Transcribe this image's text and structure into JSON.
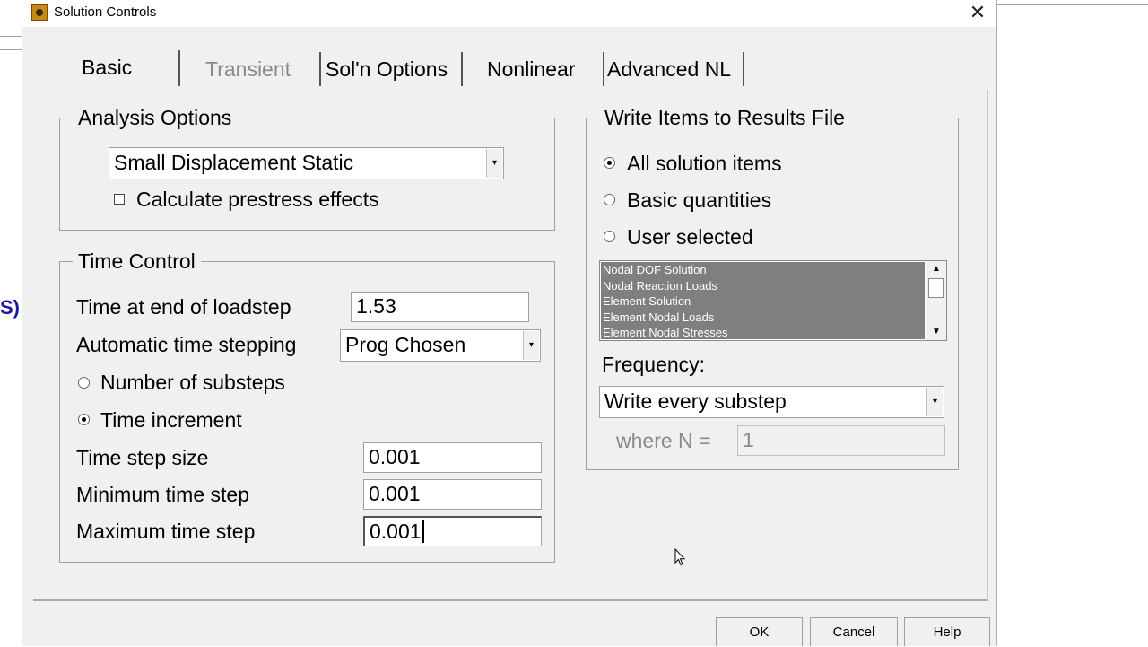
{
  "background": {
    "partial_text": "S)"
  },
  "window": {
    "title": "Solution Controls",
    "close_symbol": "✕"
  },
  "tabs": [
    {
      "label": "Basic",
      "state": "active"
    },
    {
      "label": "Transient",
      "state": "disabled"
    },
    {
      "label": "Sol'n Options",
      "state": "normal"
    },
    {
      "label": "Nonlinear",
      "state": "normal"
    },
    {
      "label": "Advanced NL",
      "state": "normal"
    }
  ],
  "analysis_options": {
    "title": "Analysis Options",
    "analysis_type": "Small Displacement Static",
    "prestress_label": "Calculate prestress effects",
    "prestress_checked": false
  },
  "time_control": {
    "title": "Time Control",
    "end_time_label": "Time at end of loadstep",
    "end_time_value": "1.53",
    "auto_step_label": "Automatic time stepping",
    "auto_step_value": "Prog Chosen",
    "radio_substeps_label": "Number of substeps",
    "radio_increment_label": "Time increment",
    "selected_radio": "Time increment",
    "step_size_label": "Time step size",
    "step_size_value": "0.001",
    "min_step_label": "Minimum time step",
    "min_step_value": "0.001",
    "max_step_label": "Maximum time step",
    "max_step_value": "0.001"
  },
  "write_items": {
    "title": "Write Items to Results File",
    "radio_all_label": "All solution items",
    "radio_basic_label": "Basic quantities",
    "radio_user_label": "User selected",
    "selected_radio": "All solution items",
    "list_items": [
      "Nodal DOF Solution",
      "Nodal Reaction Loads",
      "Element Solution",
      "Element Nodal Loads",
      "Element Nodal Stresses"
    ],
    "frequency_label": "Frequency:",
    "frequency_value": "Write every substep",
    "where_n_label": "where N =",
    "where_n_value": "1"
  },
  "buttons": {
    "ok": "OK",
    "cancel": "Cancel",
    "help": "Help"
  },
  "icons": {
    "app_icon": "ansys-gear-icon",
    "dropdown_arrow": "▾",
    "scroll_up": "▲",
    "scroll_down": "▼"
  }
}
